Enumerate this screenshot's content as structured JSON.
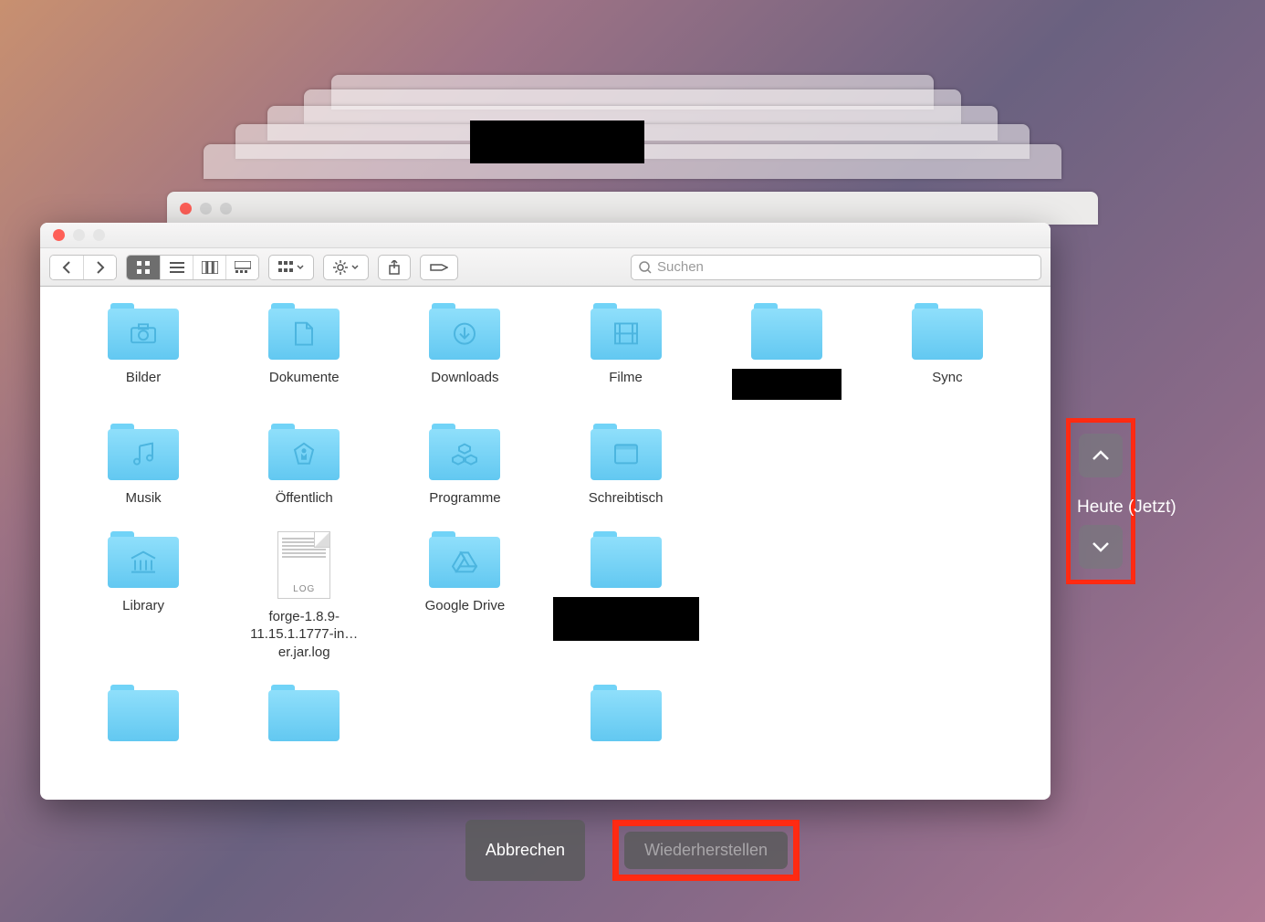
{
  "search": {
    "placeholder": "Suchen"
  },
  "timeline": {
    "label": "Heute (Jetzt)"
  },
  "buttons": {
    "cancel": "Abbrechen",
    "restore": "Wiederherstellen"
  },
  "items": [
    {
      "label": "Bilder",
      "type": "folder",
      "glyph": "camera"
    },
    {
      "label": "Dokumente",
      "type": "folder",
      "glyph": "doc"
    },
    {
      "label": "Downloads",
      "type": "folder",
      "glyph": "download"
    },
    {
      "label": "Filme",
      "type": "folder",
      "glyph": "film"
    },
    {
      "label": "",
      "type": "folder",
      "glyph": "",
      "redacted": true
    },
    {
      "label": "Sync",
      "type": "folder",
      "glyph": ""
    },
    {
      "label": "Musik",
      "type": "folder",
      "glyph": "music"
    },
    {
      "label": "Öffentlich",
      "type": "folder",
      "glyph": "public"
    },
    {
      "label": "Programme",
      "type": "folder",
      "glyph": "apps"
    },
    {
      "label": "Schreibtisch",
      "type": "folder",
      "glyph": "desktop"
    },
    {
      "label": "",
      "type": "blank"
    },
    {
      "label": "",
      "type": "blank"
    },
    {
      "label": "Library",
      "type": "folder",
      "glyph": "library"
    },
    {
      "label": "forge-1.8.9-11.15.1.1777-in…er.jar.log",
      "type": "log"
    },
    {
      "label": "Google Drive",
      "type": "folder",
      "glyph": "drive"
    },
    {
      "label": "",
      "type": "folder",
      "glyph": "",
      "redacted2": true
    },
    {
      "label": "",
      "type": "blank"
    },
    {
      "label": "",
      "type": "blank"
    },
    {
      "label": "",
      "type": "folder",
      "glyph": ""
    },
    {
      "label": "",
      "type": "folder",
      "glyph": ""
    },
    {
      "label": "",
      "type": "blank"
    },
    {
      "label": "",
      "type": "folder",
      "glyph": ""
    }
  ],
  "logfile_tag": "LOG"
}
